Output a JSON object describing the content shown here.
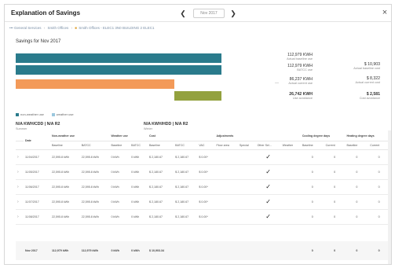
{
  "window": {
    "title": "Explanation of Savings",
    "period": "Nov 2017",
    "prev_icon": "chevron-left-icon",
    "next_icon": "chevron-right-icon",
    "close_icon": "close-icon",
    "close_glyph": "×",
    "prev_glyph": "❮",
    "next_glyph": "❯"
  },
  "breadcrumb": {
    "items": [
      "General Services",
      "Smith Offices",
      "Smith Offices - ELEC1 3N0 BUILDING 2 ELEC1"
    ]
  },
  "chart": {
    "heading": "Savings for Nov 2017",
    "colors": {
      "baseline": "#2a7b8c",
      "current": "#f39a59",
      "avoidance": "#93a13e"
    },
    "values": [
      {
        "value": "112,979 KWH",
        "label": "Actual baseline use",
        "cost": "$ 10,903",
        "cost_label": "Actual baseline cost"
      },
      {
        "value": "112,979 KWH",
        "label": "BATCC use",
        "cost": "",
        "cost_label": ""
      },
      {
        "value": "86,237 KWH",
        "label": "Actual current use",
        "cost": "$ 8,322",
        "cost_label": "Actual current cost"
      },
      {
        "value": "26,742 KWH",
        "label": "Use avoidance",
        "cost": "$ 2,581",
        "cost_label": "Cost avoidance"
      }
    ],
    "dash": "—",
    "legend": [
      {
        "label": "non-weather use",
        "color": "#2a7b8c"
      },
      {
        "label": "weather use",
        "color": "#9bc7de"
      }
    ]
  },
  "metrics": {
    "summer_value": "N/A KWH/CDD | N/A R2",
    "summer_label": "Summer",
    "winter_value": "N/A KWH/HDD | N/A R2",
    "winter_label": "Winter"
  },
  "table": {
    "group_headers": [
      "Date",
      "Non-weather use",
      "Weather use",
      "Cost",
      "Adjustments",
      "Cooling degree days",
      "Heating degree days"
    ],
    "sub_headers": [
      "Baseline",
      "BATCC",
      "Baseline",
      "BATCC",
      "Baseline",
      "BATCC",
      "VAC",
      "Floor area",
      "Special",
      "Other Sel...",
      "Weather",
      "Baseline",
      "Current",
      "Baseline",
      "Current"
    ],
    "rows": [
      {
        "date": "11/04/2017",
        "nw_baseline": "22,595.8 kWh",
        "nw_batcc": "22,595.8 kWh",
        "w_baseline": "0 kWh",
        "w_batcc": "0 kWh",
        "c_baseline": "$ 2,180.67",
        "c_batcc": "$ 2,180.67",
        "vac": "$ 0.00*",
        "check": "✓",
        "cdd_b": "0",
        "cdd_c": "0",
        "hdd_b": "0",
        "hdd_c": "0"
      },
      {
        "date": "11/05/2017",
        "nw_baseline": "22,595.8 kWh",
        "nw_batcc": "22,595.8 kWh",
        "w_baseline": "0 kWh",
        "w_batcc": "0 kWh",
        "c_baseline": "$ 2,180.67",
        "c_batcc": "$ 2,180.67",
        "vac": "$ 0.00*",
        "check": "✓",
        "cdd_b": "0",
        "cdd_c": "0",
        "hdd_b": "0",
        "hdd_c": "0"
      },
      {
        "date": "11/06/2017",
        "nw_baseline": "22,595.8 kWh",
        "nw_batcc": "22,595.8 kWh",
        "w_baseline": "0 kWh",
        "w_batcc": "0 kWh",
        "c_baseline": "$ 2,180.67",
        "c_batcc": "$ 2,180.67",
        "vac": "$ 0.00*",
        "check": "✓",
        "cdd_b": "0",
        "cdd_c": "0",
        "hdd_b": "0",
        "hdd_c": "0"
      },
      {
        "date": "11/07/2017",
        "nw_baseline": "22,595.8 kWh",
        "nw_batcc": "22,595.8 kWh",
        "w_baseline": "0 kWh",
        "w_batcc": "0 kWh",
        "c_baseline": "$ 2,180.67",
        "c_batcc": "$ 2,180.67",
        "vac": "$ 0.00*",
        "check": "✓",
        "cdd_b": "0",
        "cdd_c": "0",
        "hdd_b": "0",
        "hdd_c": "0"
      },
      {
        "date": "11/08/2017",
        "nw_baseline": "22,595.8 kWh",
        "nw_batcc": "22,595.8 kWh",
        "w_baseline": "0 kWh",
        "w_batcc": "0 kWh",
        "c_baseline": "$ 2,180.67",
        "c_batcc": "$ 2,180.67",
        "vac": "$ 0.00*",
        "check": "✓",
        "cdd_b": "0",
        "cdd_c": "0",
        "hdd_b": "0",
        "hdd_c": "0"
      }
    ],
    "total": {
      "date": "Nov 2017",
      "nw_baseline": "112,979 kWh",
      "nw_batcc": "112,979 kWh",
      "w_baseline": "0 kWh",
      "w_batcc": "0 kWh",
      "c_baseline": "$ 10,903.34",
      "cdd_b": "0",
      "cdd_c": "0",
      "hdd_b": "0",
      "hdd_c": "0"
    }
  }
}
